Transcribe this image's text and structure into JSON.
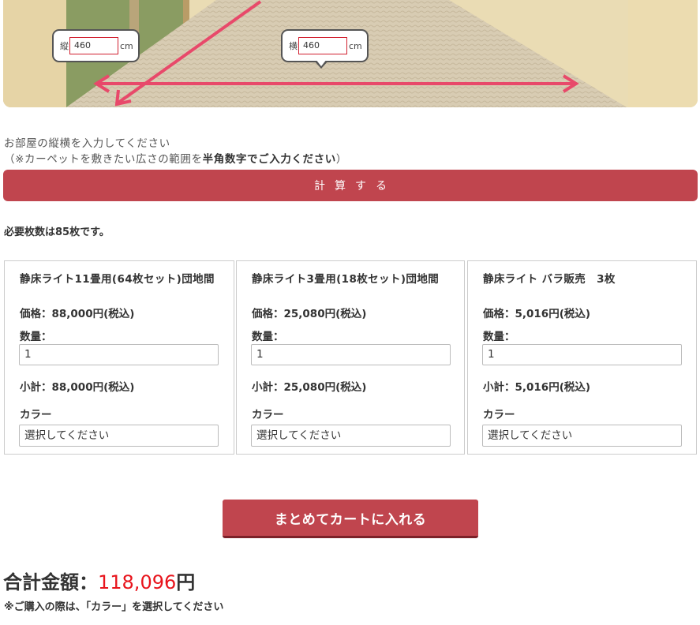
{
  "room": {
    "length_prefix": "縦",
    "length_value": "460",
    "length_unit": "cm",
    "width_prefix": "横",
    "width_value": "460",
    "width_unit": "cm"
  },
  "instruction": {
    "line1": "お部屋の縦横を入力してください",
    "line2_prefix": "（※カーペットを敷きたい広さの範囲を",
    "line2_bold": "半角数字でご入力ください",
    "line2_suffix": "）"
  },
  "calc_button_label": "計算する",
  "result_text": "必要枚数は85枚です。",
  "products": [
    {
      "name": "静床ライト11畳用(64枚セット)団地間",
      "price": "価格：88,000円(税込)",
      "qty_label": "数量：",
      "qty_value": "1",
      "subtotal": "小計：88,000円(税込)",
      "color_label": "カラー",
      "color_select": "選択してください"
    },
    {
      "name": "静床ライト3畳用(18枚セット)団地間",
      "price": "価格：25,080円(税込)",
      "qty_label": "数量：",
      "qty_value": "1",
      "subtotal": "小計：25,080円(税込)",
      "color_label": "カラー",
      "color_select": "選択してください"
    },
    {
      "name": "静床ライト バラ販売　3枚",
      "price": "価格：5,016円(税込)",
      "qty_label": "数量：",
      "qty_value": "1",
      "subtotal": "小計：5,016円(税込)",
      "color_label": "カラー",
      "color_select": "選択してください"
    }
  ],
  "cart_button_label": "まとめてカートに入れる",
  "total": {
    "label": "合計金額：",
    "amount": "118,096",
    "unit": "円"
  },
  "note": "※ご購入の際は、「カラー」を選択してください",
  "colors": {
    "accent": "#c0454e",
    "arrow": "#e8496a",
    "total_amount": "#e8141c"
  }
}
